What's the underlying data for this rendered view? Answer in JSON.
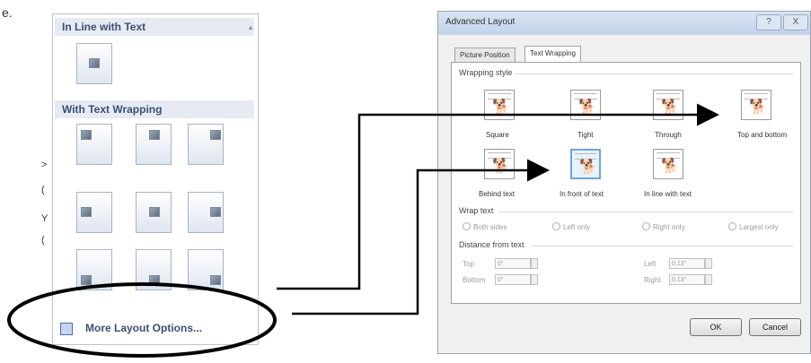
{
  "edge_fragments": [
    "e.",
    ">",
    "(",
    "Y",
    "("
  ],
  "gallery": {
    "in_line_header": "In Line with Text",
    "with_wrapping_header": "With Text Wrapping",
    "more_options_label": "More Layout Options...",
    "scroll_glyph": "▲"
  },
  "dialog": {
    "title": "Advanced Layout",
    "help_glyph": "?",
    "close_glyph": "X",
    "tabs": [
      "Picture Position",
      "Text Wrapping"
    ],
    "active_tab": "Text Wrapping",
    "wrapping_style_label": "Wrapping style",
    "wrap_styles": [
      "Square",
      "Tight",
      "Through",
      "Top and bottom",
      "Behind text",
      "In front of text",
      "In line with text"
    ],
    "selected_style": "In front of text",
    "wrap_text_label": "Wrap text",
    "wrap_text_options": [
      "Both sides",
      "Left only",
      "Right only",
      "Largest only"
    ],
    "distance_label": "Distance from text",
    "distance": {
      "top_label": "Top",
      "top_value": "0\"",
      "bottom_label": "Bottom",
      "bottom_value": "0\"",
      "left_label": "Left",
      "left_value": "0.13\"",
      "right_label": "Right",
      "right_value": "0.13\""
    },
    "ok_label": "OK",
    "cancel_label": "Cancel",
    "dog_glyph": "🐕"
  },
  "colors": {
    "arrow": "#000000",
    "header_text": "#3b4f73",
    "selection_border": "#6aa6e0"
  }
}
